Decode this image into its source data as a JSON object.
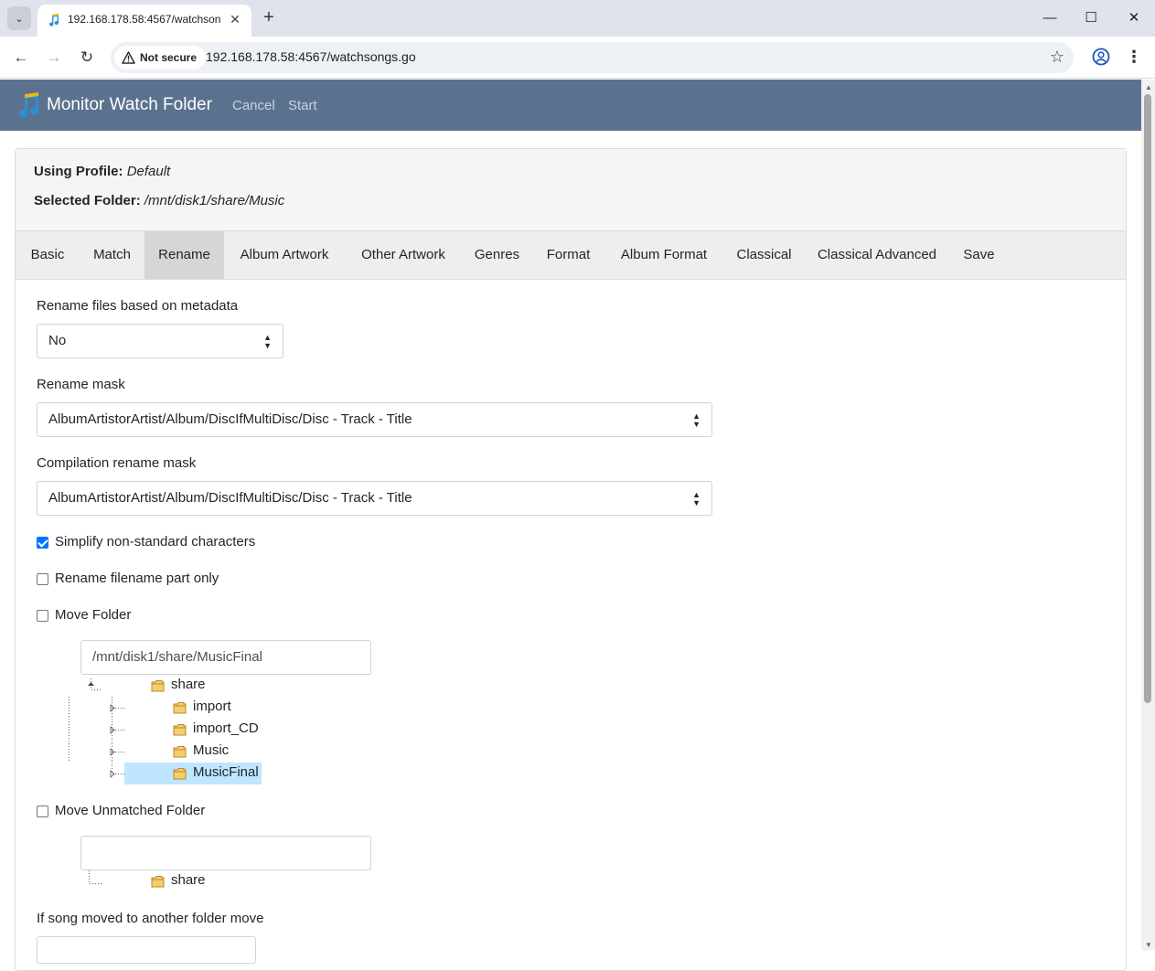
{
  "browser": {
    "tab_title": "192.168.178.58:4567/watchsongs",
    "security_label": "Not secure",
    "url": "192.168.178.58:4567/watchsongs.go",
    "new_tab_symbol": "+",
    "minimize_symbol": "—",
    "maximize_symbol": "☐",
    "close_symbol": "✕",
    "tab_close_symbol": "✕",
    "back_symbol": "←",
    "forward_symbol": "→",
    "reload_symbol": "↻",
    "bookmark_symbol": "☆",
    "menu_symbol": "⋮",
    "dropdown_symbol": "⌄"
  },
  "app": {
    "title": "Monitor Watch Folder",
    "nav": [
      "Cancel",
      "Start"
    ]
  },
  "header": {
    "profile_label": "Using Profile:",
    "profile_value": "Default",
    "folder_label": "Selected Folder:",
    "folder_value": "/mnt/disk1/share/Music"
  },
  "tabs": [
    "Basic",
    "Match",
    "Rename",
    "Album Artwork",
    "Other Artwork",
    "Genres",
    "Format",
    "Album Format",
    "Classical",
    "Classical Advanced",
    "Save"
  ],
  "active_tab": "Rename",
  "form": {
    "rename_label": "Rename files based on metadata",
    "rename_value": "No",
    "mask_label": "Rename mask",
    "mask_value": "AlbumArtistorArtist/Album/DiscIfMultiDisc/Disc - Track - Title",
    "comp_mask_label": "Compilation rename mask",
    "comp_mask_value": "AlbumArtistorArtist/Album/DiscIfMultiDisc/Disc - Track - Title",
    "simplify_label": "Simplify non-standard characters",
    "simplify_checked": true,
    "filename_only_label": "Rename filename part only",
    "filename_only_checked": false,
    "move_folder_label": "Move Folder",
    "move_folder_checked": false,
    "move_folder_path": "/mnt/disk1/share/MusicFinal",
    "move_tree": {
      "root": "share",
      "children": [
        "import",
        "import_CD",
        "Music",
        "MusicFinal"
      ],
      "selected": "MusicFinal"
    },
    "unmatched_label": "Move Unmatched Folder",
    "unmatched_checked": false,
    "unmatched_path": "",
    "unmatched_tree_root": "share",
    "moved_label": "If song moved to another folder move"
  },
  "colors": {
    "app_nav_bg": "#5b728f",
    "checkbox_accent": "#0075ff",
    "tree_selection": "#bfe6ff",
    "active_tab_bg": "#d6d6d6"
  }
}
